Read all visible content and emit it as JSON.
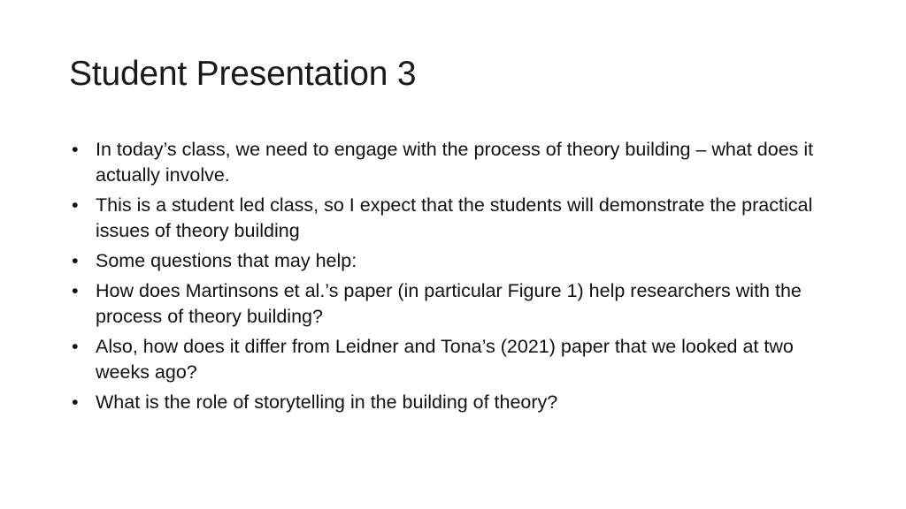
{
  "slide": {
    "title": "Student Presentation 3",
    "bullet_glyph": "•",
    "bullets": [
      "In today’s class, we need to engage with the process of theory building – what does it actually involve.",
      "This is a student led class, so I expect that the students will demonstrate the practical issues of theory building",
      "Some questions that may help:",
      "How does Martinsons et al.’s paper (in particular Figure 1) help researchers with the process of theory building?",
      "Also, how does it differ from Leidner and Tona’s (2021) paper that we looked at two weeks ago?",
      "What is the role of storytelling in the building of theory?"
    ]
  }
}
